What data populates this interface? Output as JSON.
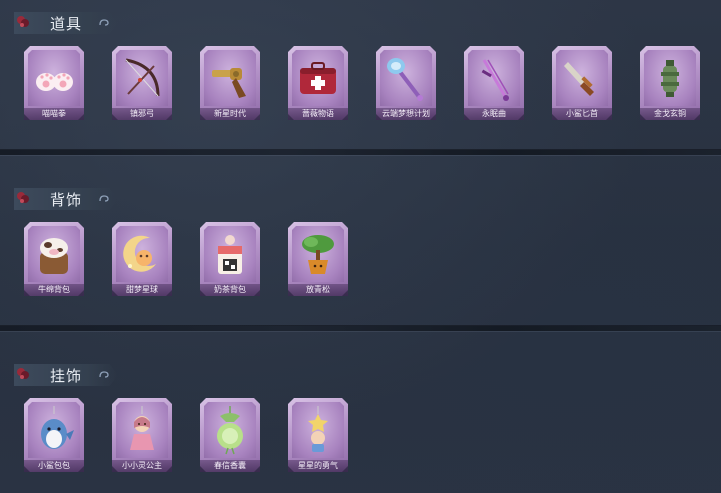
{
  "sections": [
    {
      "title": "道具",
      "items": [
        {
          "label": "喵喵拳",
          "icon": "cat-paw-gloves-icon"
        },
        {
          "label": "镇邪弓",
          "icon": "bow-icon"
        },
        {
          "label": "新星时代",
          "icon": "revolver-icon"
        },
        {
          "label": "蔷薇物语",
          "icon": "medkit-icon"
        },
        {
          "label": "云端梦想计划",
          "icon": "crystal-mace-icon"
        },
        {
          "label": "永眠曲",
          "icon": "violin-bow-sword-icon"
        },
        {
          "label": "小鲨匕首",
          "icon": "dagger-icon"
        },
        {
          "label": "金戈玄铜",
          "icon": "bronze-lantern-icon"
        }
      ]
    },
    {
      "title": "背饰",
      "items": [
        {
          "label": "牛绵背包",
          "icon": "cow-backpack-icon"
        },
        {
          "label": "甜梦星球",
          "icon": "moon-planet-icon"
        },
        {
          "label": "奶茶背包",
          "icon": "milk-tea-backpack-icon"
        },
        {
          "label": "放青松",
          "icon": "potted-pine-icon"
        }
      ]
    },
    {
      "title": "挂饰",
      "items": [
        {
          "label": "小鲨包包",
          "icon": "shark-charm-icon"
        },
        {
          "label": "小小灵公主",
          "icon": "princess-charm-icon"
        },
        {
          "label": "春信香囊",
          "icon": "sachet-charm-icon"
        },
        {
          "label": "星星的勇气",
          "icon": "star-doll-charm-icon"
        }
      ]
    }
  ]
}
